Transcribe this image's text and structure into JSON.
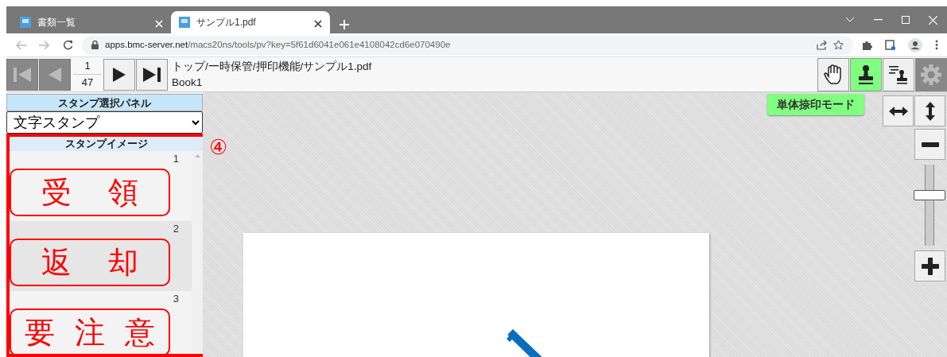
{
  "browser": {
    "tabs": [
      {
        "title": "書類一覧",
        "selected": false
      },
      {
        "title": "サンプル1.pdf",
        "selected": true
      }
    ],
    "url": {
      "host": "apps.bmc-server.net",
      "path": "/macs20ns/tools/pv?key=5f61d6041e061e4108042cd6e070490e"
    }
  },
  "toolbar": {
    "nav_buttons": [
      {
        "kind": "first",
        "disabled": true
      },
      {
        "kind": "prev",
        "disabled": true
      },
      {
        "kind": "next",
        "disabled": false
      },
      {
        "kind": "last",
        "disabled": false
      }
    ],
    "page": {
      "current": "1",
      "total": "47"
    },
    "path": "トップ/一時保管/押印機能/サンプル1.pdf",
    "book": "Book1",
    "tools": [
      {
        "kind": "hand",
        "selected": false,
        "disabled": false
      },
      {
        "kind": "stamp",
        "selected": true,
        "disabled": false
      },
      {
        "kind": "stamp-list",
        "selected": false,
        "disabled": false
      },
      {
        "kind": "settings",
        "disabled": true
      }
    ]
  },
  "panel": {
    "title": "スタンプ選択パネル",
    "select_value": "文字スタンプ",
    "images_title": "スタンプイメージ",
    "stamps": [
      {
        "number": "1",
        "text": "受 領",
        "selected": false
      },
      {
        "number": "2",
        "text": "返 却",
        "selected": true
      },
      {
        "number": "3",
        "text": "要 注 意",
        "selected": false
      }
    ]
  },
  "annotation": "④",
  "mode_label": "単体捺印モード",
  "zoom": {
    "level": 0.63
  }
}
